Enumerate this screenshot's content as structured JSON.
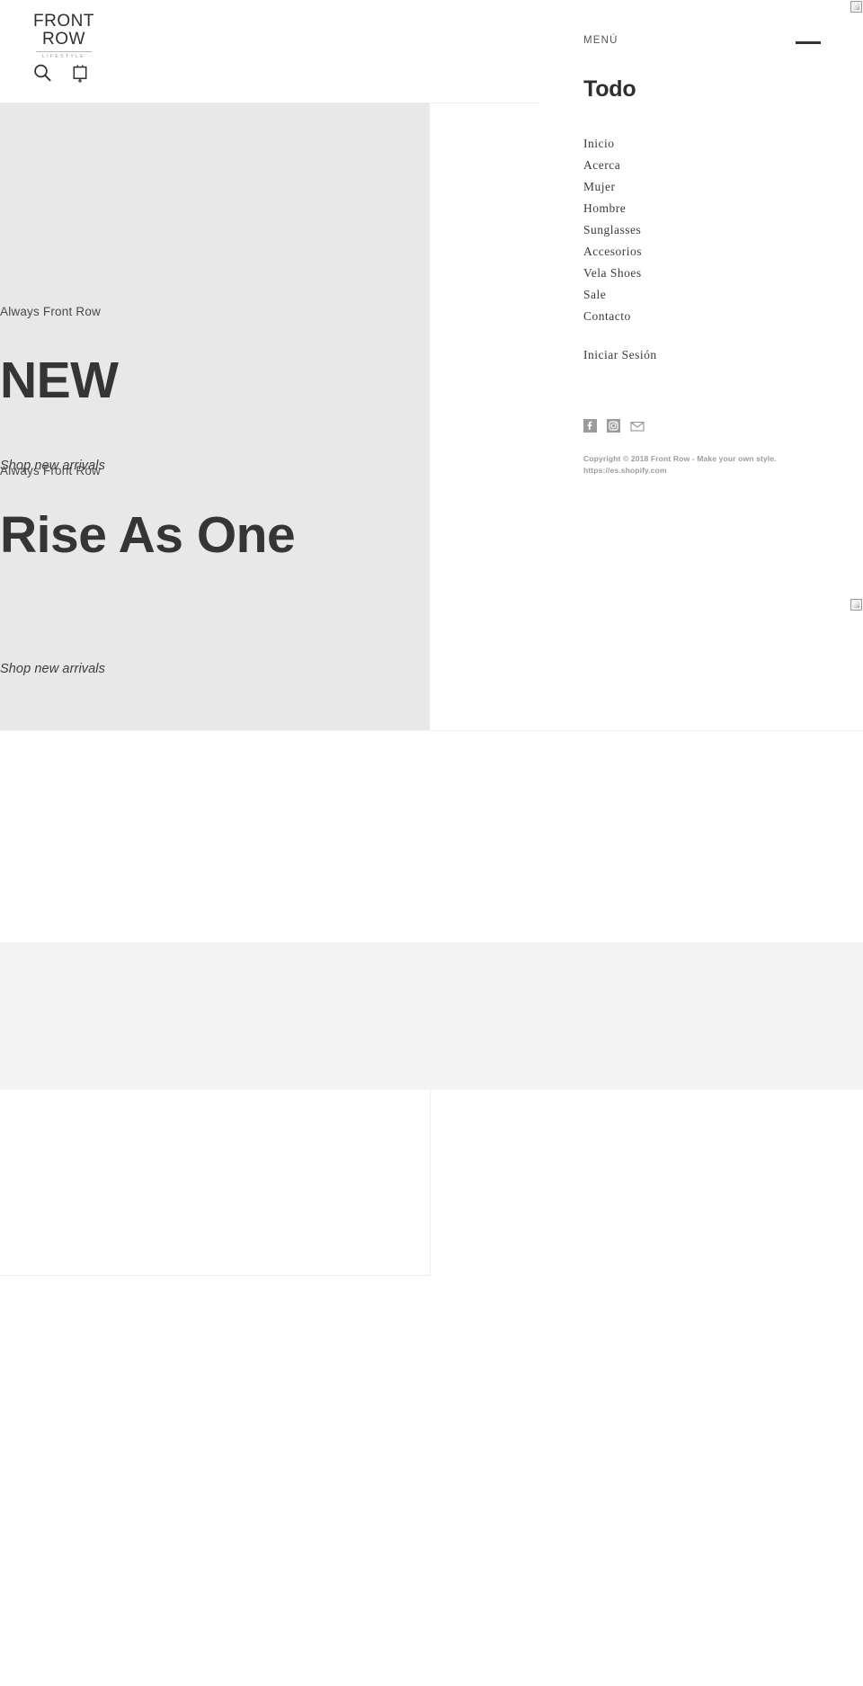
{
  "header": {
    "logo": {
      "line1": "FRONT",
      "line2": "ROW",
      "tagline": "LIFESTYLE"
    },
    "icons": {
      "search": "search-icon",
      "cart": "shopping-bag-icon"
    }
  },
  "hero": {
    "background_color": "#e8e8e8",
    "slides": [
      {
        "kicker": "Always Front Row",
        "title": "NEW",
        "cta": "Shop new arrivals"
      },
      {
        "kicker": "Always Front Row",
        "title": "Rise As One",
        "cta": "Shop new arrivals"
      }
    ]
  },
  "drawer": {
    "label": "MENÚ",
    "toggle_icon": "hamburger-icon",
    "heading": "Todo",
    "nav_items": [
      {
        "label": "Inicio"
      },
      {
        "label": "Acerca"
      },
      {
        "label": "Mujer"
      },
      {
        "label": "Hombre"
      },
      {
        "label": "Sunglasses"
      },
      {
        "label": "Accesorios"
      },
      {
        "label": "Vela Shoes"
      },
      {
        "label": "Sale"
      },
      {
        "label": "Contacto"
      }
    ],
    "account_link": "Iniciar Sesión",
    "social": [
      {
        "name": "facebook-icon"
      },
      {
        "name": "instagram-icon"
      },
      {
        "name": "email-icon"
      }
    ],
    "copyright": "Copyright © 2018 Front Row - Make your own style. https://es.shopify.com"
  },
  "sections": {
    "gray_band_color": "#f4f4f4",
    "divider_color": "#ededed"
  }
}
